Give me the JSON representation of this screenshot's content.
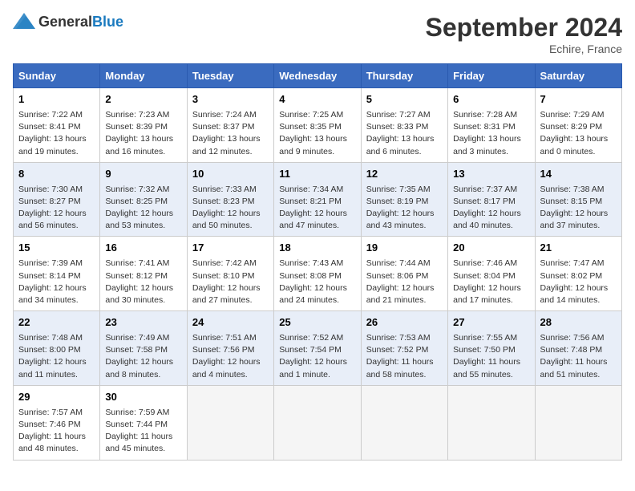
{
  "header": {
    "logo_general": "General",
    "logo_blue": "Blue",
    "month": "September 2024",
    "location": "Echire, France"
  },
  "days_of_week": [
    "Sunday",
    "Monday",
    "Tuesday",
    "Wednesday",
    "Thursday",
    "Friday",
    "Saturday"
  ],
  "weeks": [
    [
      {
        "day": "1",
        "info": "Sunrise: 7:22 AM\nSunset: 8:41 PM\nDaylight: 13 hours\nand 19 minutes."
      },
      {
        "day": "2",
        "info": "Sunrise: 7:23 AM\nSunset: 8:39 PM\nDaylight: 13 hours\nand 16 minutes."
      },
      {
        "day": "3",
        "info": "Sunrise: 7:24 AM\nSunset: 8:37 PM\nDaylight: 13 hours\nand 12 minutes."
      },
      {
        "day": "4",
        "info": "Sunrise: 7:25 AM\nSunset: 8:35 PM\nDaylight: 13 hours\nand 9 minutes."
      },
      {
        "day": "5",
        "info": "Sunrise: 7:27 AM\nSunset: 8:33 PM\nDaylight: 13 hours\nand 6 minutes."
      },
      {
        "day": "6",
        "info": "Sunrise: 7:28 AM\nSunset: 8:31 PM\nDaylight: 13 hours\nand 3 minutes."
      },
      {
        "day": "7",
        "info": "Sunrise: 7:29 AM\nSunset: 8:29 PM\nDaylight: 13 hours\nand 0 minutes."
      }
    ],
    [
      {
        "day": "8",
        "info": "Sunrise: 7:30 AM\nSunset: 8:27 PM\nDaylight: 12 hours\nand 56 minutes."
      },
      {
        "day": "9",
        "info": "Sunrise: 7:32 AM\nSunset: 8:25 PM\nDaylight: 12 hours\nand 53 minutes."
      },
      {
        "day": "10",
        "info": "Sunrise: 7:33 AM\nSunset: 8:23 PM\nDaylight: 12 hours\nand 50 minutes."
      },
      {
        "day": "11",
        "info": "Sunrise: 7:34 AM\nSunset: 8:21 PM\nDaylight: 12 hours\nand 47 minutes."
      },
      {
        "day": "12",
        "info": "Sunrise: 7:35 AM\nSunset: 8:19 PM\nDaylight: 12 hours\nand 43 minutes."
      },
      {
        "day": "13",
        "info": "Sunrise: 7:37 AM\nSunset: 8:17 PM\nDaylight: 12 hours\nand 40 minutes."
      },
      {
        "day": "14",
        "info": "Sunrise: 7:38 AM\nSunset: 8:15 PM\nDaylight: 12 hours\nand 37 minutes."
      }
    ],
    [
      {
        "day": "15",
        "info": "Sunrise: 7:39 AM\nSunset: 8:14 PM\nDaylight: 12 hours\nand 34 minutes."
      },
      {
        "day": "16",
        "info": "Sunrise: 7:41 AM\nSunset: 8:12 PM\nDaylight: 12 hours\nand 30 minutes."
      },
      {
        "day": "17",
        "info": "Sunrise: 7:42 AM\nSunset: 8:10 PM\nDaylight: 12 hours\nand 27 minutes."
      },
      {
        "day": "18",
        "info": "Sunrise: 7:43 AM\nSunset: 8:08 PM\nDaylight: 12 hours\nand 24 minutes."
      },
      {
        "day": "19",
        "info": "Sunrise: 7:44 AM\nSunset: 8:06 PM\nDaylight: 12 hours\nand 21 minutes."
      },
      {
        "day": "20",
        "info": "Sunrise: 7:46 AM\nSunset: 8:04 PM\nDaylight: 12 hours\nand 17 minutes."
      },
      {
        "day": "21",
        "info": "Sunrise: 7:47 AM\nSunset: 8:02 PM\nDaylight: 12 hours\nand 14 minutes."
      }
    ],
    [
      {
        "day": "22",
        "info": "Sunrise: 7:48 AM\nSunset: 8:00 PM\nDaylight: 12 hours\nand 11 minutes."
      },
      {
        "day": "23",
        "info": "Sunrise: 7:49 AM\nSunset: 7:58 PM\nDaylight: 12 hours\nand 8 minutes."
      },
      {
        "day": "24",
        "info": "Sunrise: 7:51 AM\nSunset: 7:56 PM\nDaylight: 12 hours\nand 4 minutes."
      },
      {
        "day": "25",
        "info": "Sunrise: 7:52 AM\nSunset: 7:54 PM\nDaylight: 12 hours\nand 1 minute."
      },
      {
        "day": "26",
        "info": "Sunrise: 7:53 AM\nSunset: 7:52 PM\nDaylight: 11 hours\nand 58 minutes."
      },
      {
        "day": "27",
        "info": "Sunrise: 7:55 AM\nSunset: 7:50 PM\nDaylight: 11 hours\nand 55 minutes."
      },
      {
        "day": "28",
        "info": "Sunrise: 7:56 AM\nSunset: 7:48 PM\nDaylight: 11 hours\nand 51 minutes."
      }
    ],
    [
      {
        "day": "29",
        "info": "Sunrise: 7:57 AM\nSunset: 7:46 PM\nDaylight: 11 hours\nand 48 minutes."
      },
      {
        "day": "30",
        "info": "Sunrise: 7:59 AM\nSunset: 7:44 PM\nDaylight: 11 hours\nand 45 minutes."
      },
      {
        "day": "",
        "info": ""
      },
      {
        "day": "",
        "info": ""
      },
      {
        "day": "",
        "info": ""
      },
      {
        "day": "",
        "info": ""
      },
      {
        "day": "",
        "info": ""
      }
    ]
  ]
}
